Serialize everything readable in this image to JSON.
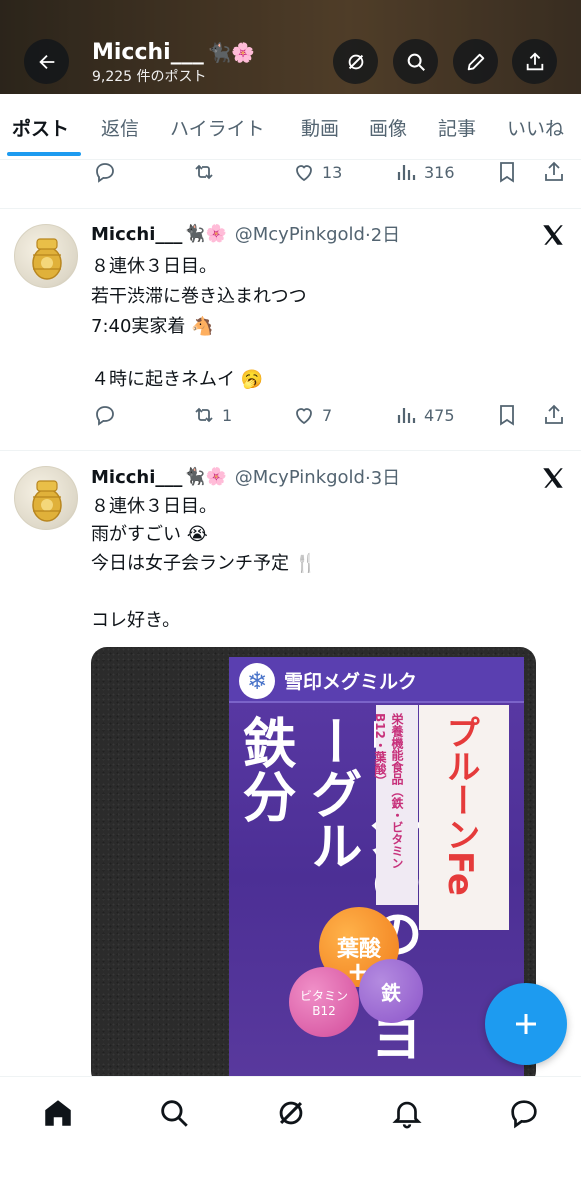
{
  "header": {
    "name": "Micchi___",
    "emojis": "🐈‍⬛🌸",
    "post_count": "9,225 件のポスト",
    "icons": [
      "back-arrow-icon",
      "grok-icon",
      "search-icon",
      "pencil-icon",
      "share-icon"
    ]
  },
  "tabs": [
    "ポスト",
    "返信",
    "ハイライト",
    "動画",
    "画像",
    "記事",
    "いいね"
  ],
  "active_tab": "ポスト",
  "top_actions": {
    "replies": "",
    "reposts": "",
    "likes": "13",
    "views": "316"
  },
  "tweets": [
    {
      "name": "Micchi___",
      "emojis": "🐈‍⬛🌸",
      "handle": "@McyPinkgold",
      "time": "·2日",
      "lines": [
        "８連休３日目。",
        "若干渋滞に巻き込まれつつ",
        "7:40実家着 🐴",
        "",
        "４時に起きネムイ 🥱"
      ],
      "replies": "",
      "reposts": "1",
      "likes": "7",
      "views": "475"
    },
    {
      "name": "Micchi___",
      "emojis": "🐈‍⬛🌸",
      "handle": "@McyPinkgold",
      "time": "·3日",
      "lines": [
        "８連休３日目。",
        "雨がすごい 😭",
        "今日は女子会ランチ予定 🍴",
        "",
        "コレ好き。"
      ]
    }
  ],
  "media": {
    "brand": "雪印メグミルク",
    "big_text_1": "鉄",
    "big_text_1b": "分",
    "big_text_2": "1日分の",
    "big_text_2b": "のむヨーグル",
    "side_text": "栄養機能食品（鉄・ビタミンB12・葉酸）",
    "prune": "プルーンFe",
    "badge_folic": "葉酸",
    "badge_vitamin_1": "ビタミン",
    "badge_vitamin_2": "B12",
    "badge_iron": "鉄",
    "badge_plus": "+"
  },
  "colors": {
    "accent": "#1d9bf0",
    "text": "#0f1419",
    "secondary": "#536471"
  },
  "bottom_nav": [
    "home-icon",
    "search-icon",
    "grok-icon",
    "notifications-icon",
    "messages-icon"
  ]
}
